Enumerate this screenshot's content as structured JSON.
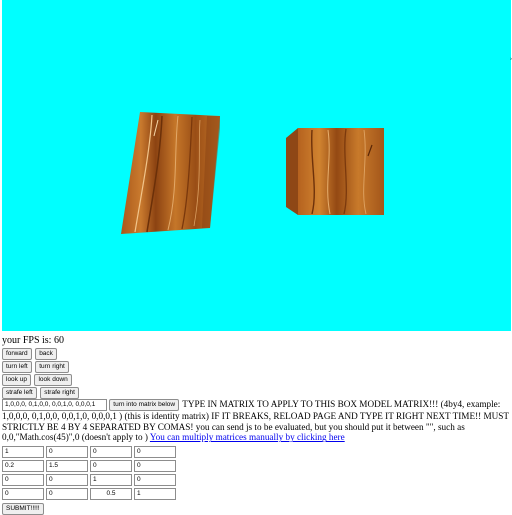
{
  "fps": {
    "text": "your FPS is: 60"
  },
  "buttons": {
    "forward": "forward",
    "back": "back",
    "turn_left": "turn left",
    "turn_right": "turn right",
    "look_up": "look up",
    "look_down": "look down",
    "strafe_left": "strafe left",
    "strafe_right": "strafe right",
    "turn_into_matrix": "turn into matrix below",
    "submit": "SUBMIT!!!!!"
  },
  "matrix_input": {
    "value": "1,0,0,0, 0,1,0,0, 0,0,1,0, 0,0,0,1"
  },
  "instructions": {
    "text": "TYPE IN MATRIX TO APPLY TO THIS BOX MODEL MATRIX!!! (4by4, example: 1,0,0,0, 0,1,0,0, 0,0,1,0, 0,0,0,1 ) (this is identity matrix) IF IT BREAKS, RELOAD PAGE AND TYPE IT RIGHT NEXT TIME!! MUST STRICTLY BE 4 BY 4 SEPARATED BY COMAS! you can send js to be evaluated, but you should put it between \"\", such as 0,0,\"Math.cos(45)\",0 (doesn't apply to )",
    "link": "You can multiply matrices manually by clicking here"
  },
  "matrix_grid": [
    [
      "1",
      "0",
      "0",
      "0"
    ],
    [
      "0.2",
      "1.5",
      "0",
      "0"
    ],
    [
      "0",
      "0",
      "1",
      "0"
    ],
    [
      "0",
      "0",
      "0.5",
      "1"
    ]
  ],
  "colors": {
    "viewport_bg": "#00ffff",
    "wood_base": "#b0641c",
    "link": "#0000ee"
  }
}
